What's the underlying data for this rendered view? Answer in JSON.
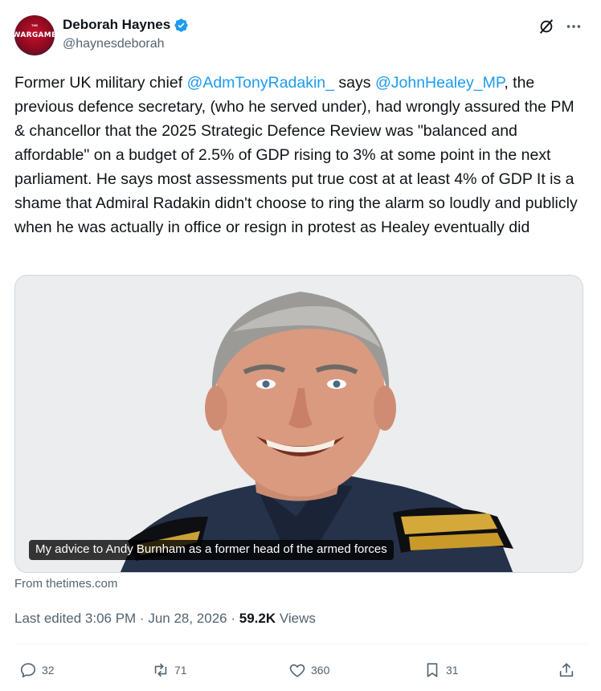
{
  "author": {
    "display_name": "Deborah Haynes",
    "handle": "@haynesdeborah",
    "avatar_text": "WARGAME",
    "avatar_small": "THE"
  },
  "tweet": {
    "text_parts": [
      "Former UK military chief ",
      "@AdmTonyRadakin_",
      " says ",
      "@JohnHealey_MP",
      ", the previous defence secretary, (who he served under), had wrongly assured the PM & chancellor that the 2025 Strategic Defence Review was \"balanced and affordable\" on a budget of 2.5% of GDP rising to 3% at some point in the next parliament. He says most assessments put true cost at at least 4% of GDP It is a shame that Admiral Radakin didn't choose to ring the alarm so loudly and publicly when he was actually in office or resign in protest as Healey eventually did"
    ]
  },
  "card": {
    "caption": "My advice to Andy Burnham as a former head of the armed forces",
    "source": "From thetimes.com"
  },
  "meta": {
    "edited": "Last edited 3:06 PM · Jun 28, 2026 · ",
    "views_count": "59.2K",
    "views_label": " Views"
  },
  "actions": {
    "replies": "32",
    "reposts": "71",
    "likes": "360",
    "bookmarks": "31"
  },
  "colors": {
    "accent": "#1d9bf0",
    "text": "#0f1419",
    "muted": "#536471"
  },
  "icons": [
    "verified-badge-icon",
    "grok-icon",
    "more-icon",
    "reply-icon",
    "repost-icon",
    "like-icon",
    "bookmark-icon",
    "share-icon"
  ]
}
